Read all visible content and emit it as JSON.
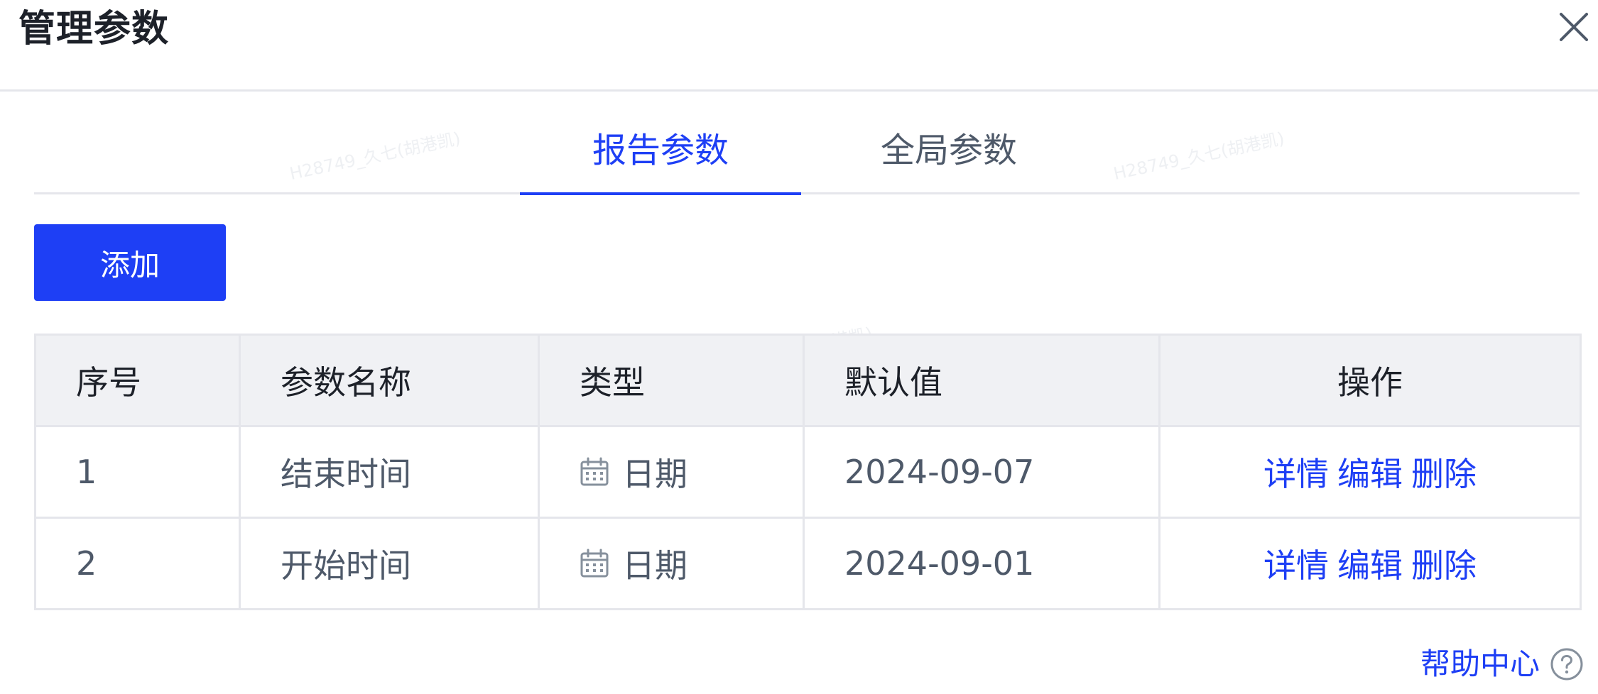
{
  "dialog": {
    "title": "管理参数"
  },
  "tabs": [
    {
      "label": "报告参数",
      "active": true
    },
    {
      "label": "全局参数",
      "active": false
    }
  ],
  "toolbar": {
    "add_label": "添加"
  },
  "table": {
    "headers": [
      "序号",
      "参数名称",
      "类型",
      "默认值",
      "操作"
    ],
    "rows": [
      {
        "index": "1",
        "name": "结束时间",
        "type": "日期",
        "default": "2024-09-07",
        "actions": [
          "详情",
          "编辑",
          "删除"
        ]
      },
      {
        "index": "2",
        "name": "开始时间",
        "type": "日期",
        "default": "2024-09-01",
        "actions": [
          "详情",
          "编辑",
          "删除"
        ]
      }
    ]
  },
  "help": {
    "label": "帮助中心"
  },
  "watermark": {
    "text": "H28749_久七(胡港凯)"
  },
  "colors": {
    "accent": "#1e3ff5",
    "header_bg": "#f0f1f4",
    "border": "#e5e6eb",
    "title": "#1d2129",
    "text": "#4e5969"
  },
  "icons": {
    "close": "close-icon",
    "calendar": "calendar-icon",
    "help": "question-circle-icon"
  }
}
